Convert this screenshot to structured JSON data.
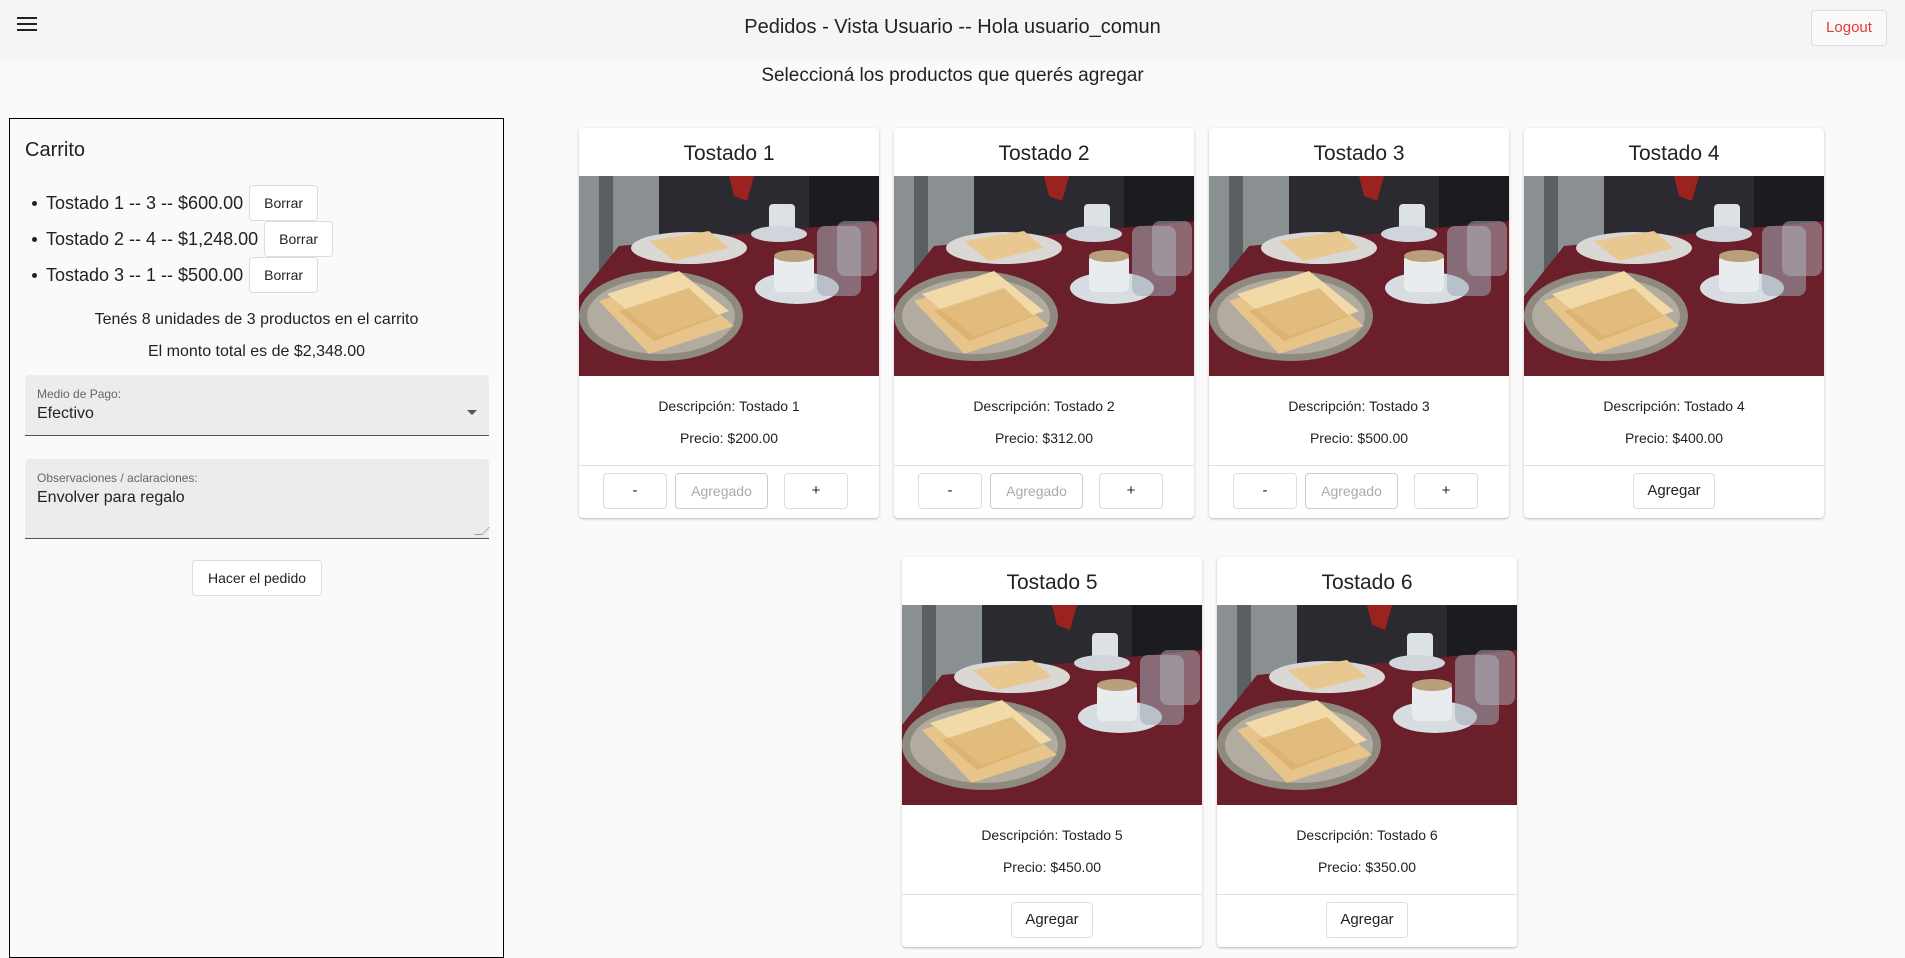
{
  "header": {
    "title": "Pedidos - Vista Usuario -- Hola usuario_comun",
    "logout_label": "Logout",
    "menu_icon": "hamburger-menu-icon"
  },
  "subtitle": "Seleccioná los productos que querés agregar",
  "cart": {
    "title": "Carrito",
    "items": [
      {
        "text": "Tostado 1 -- 3 -- $600.00",
        "delete_label": "Borrar"
      },
      {
        "text": "Tostado 2 -- 4 -- $1,248.00",
        "delete_label": "Borrar"
      },
      {
        "text": "Tostado 3 -- 1 -- $500.00",
        "delete_label": "Borrar"
      }
    ],
    "units_text": "Tenés 8 unidades de 3 productos en el carrito",
    "total_text": "El monto total es de $2,348.00",
    "payment": {
      "label": "Medio de Pago:",
      "value": "Efectivo"
    },
    "notes": {
      "label": "Observaciones / aclaraciones:",
      "value": "Envolver para regalo"
    },
    "order_label": "Hacer el pedido"
  },
  "products": [
    {
      "name": "Tostado 1",
      "description": "Descripción: Tostado 1",
      "price": "Precio: $200.00",
      "in_cart": true,
      "minus": "-",
      "plus": "+",
      "added_placeholder": "Agregado"
    },
    {
      "name": "Tostado 2",
      "description": "Descripción: Tostado 2",
      "price": "Precio: $312.00",
      "in_cart": true,
      "minus": "-",
      "plus": "+",
      "added_placeholder": "Agregado"
    },
    {
      "name": "Tostado 3",
      "description": "Descripción: Tostado 3",
      "price": "Precio: $500.00",
      "in_cart": true,
      "minus": "-",
      "plus": "+",
      "added_placeholder": "Agregado"
    },
    {
      "name": "Tostado 4",
      "description": "Descripción: Tostado 4",
      "price": "Precio: $400.00",
      "in_cart": false,
      "add_label": "Agregar"
    },
    {
      "name": "Tostado 5",
      "description": "Descripción: Tostado 5",
      "price": "Precio: $450.00",
      "in_cart": false,
      "add_label": "Agregar"
    },
    {
      "name": "Tostado 6",
      "description": "Descripción: Tostado 6",
      "price": "Precio: $350.00",
      "in_cart": false,
      "add_label": "Agregar"
    }
  ],
  "colors": {
    "logout": "#e53935",
    "table_red": "#6b1f2a"
  }
}
